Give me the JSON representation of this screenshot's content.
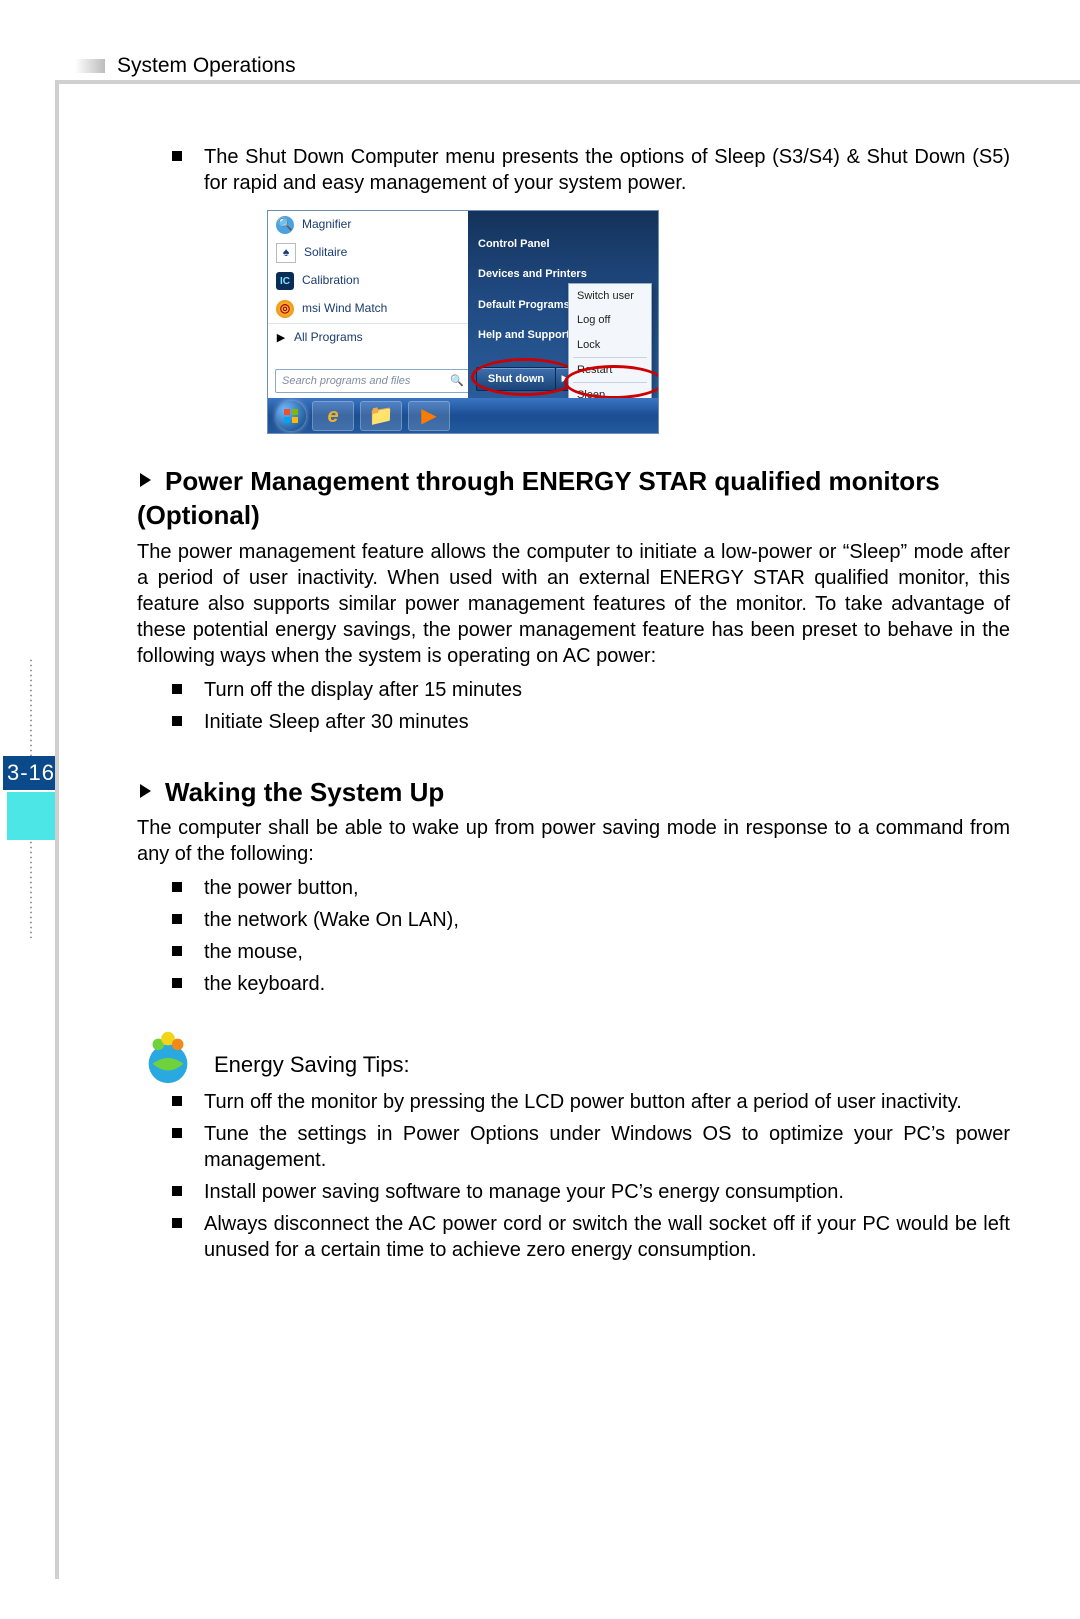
{
  "header": {
    "title": "System Operations"
  },
  "page_number": "3-16",
  "intro_bullet": "The Shut Down Computer menu presents the options of Sleep (S3/S4) & Shut Down (S5) for rapid and easy management of your system power.",
  "screenshot": {
    "left_menu": {
      "items": [
        "Magnifier",
        "Solitaire",
        "Calibration",
        "msi Wind Match"
      ],
      "all_programs": "All Programs",
      "search_placeholder": "Search programs and files"
    },
    "right_menu": {
      "items": [
        "Control Panel",
        "Devices and Printers",
        "Default Programs",
        "Help and Support"
      ]
    },
    "shutdown_button": "Shut down",
    "flyout": {
      "items_top": [
        "Switch user",
        "Log off",
        "Lock"
      ],
      "items_bottom": [
        "Restart",
        "Sleep"
      ]
    }
  },
  "section1": {
    "title": "Power Management through ENERGY STAR qualified monitors (Optional)",
    "text": "The power management feature allows the computer to initiate a low-power or “Sleep” mode after a period of user inactivity. When used with an external ENERGY STAR qualified monitor, this feature also supports similar power management features of the monitor. To take advantage of these potential energy savings, the power management feature has been preset to behave in the following ways when the system is operating on AC power:",
    "bullets": [
      "Turn off the display after 15 minutes",
      "Initiate Sleep after 30 minutes"
    ]
  },
  "section2": {
    "title": "Waking the System Up",
    "text": "The computer shall be able to wake up from power saving mode in response to a command from any of the following:",
    "bullets": [
      "the power button,",
      "the network (Wake On LAN),",
      "the mouse,",
      "the keyboard."
    ]
  },
  "tips": {
    "title": "Energy Saving Tips:",
    "bullets": [
      "Turn off the monitor by pressing the LCD power button after a period of user inactivity.",
      "Tune the settings in Power Options under Windows OS to optimize your PC’s power management.",
      "Install power saving software to manage your PC’s energy consumption.",
      "Always disconnect the AC power cord or switch the wall socket off if your PC would be left unused for a certain time to achieve zero energy consumption."
    ]
  }
}
